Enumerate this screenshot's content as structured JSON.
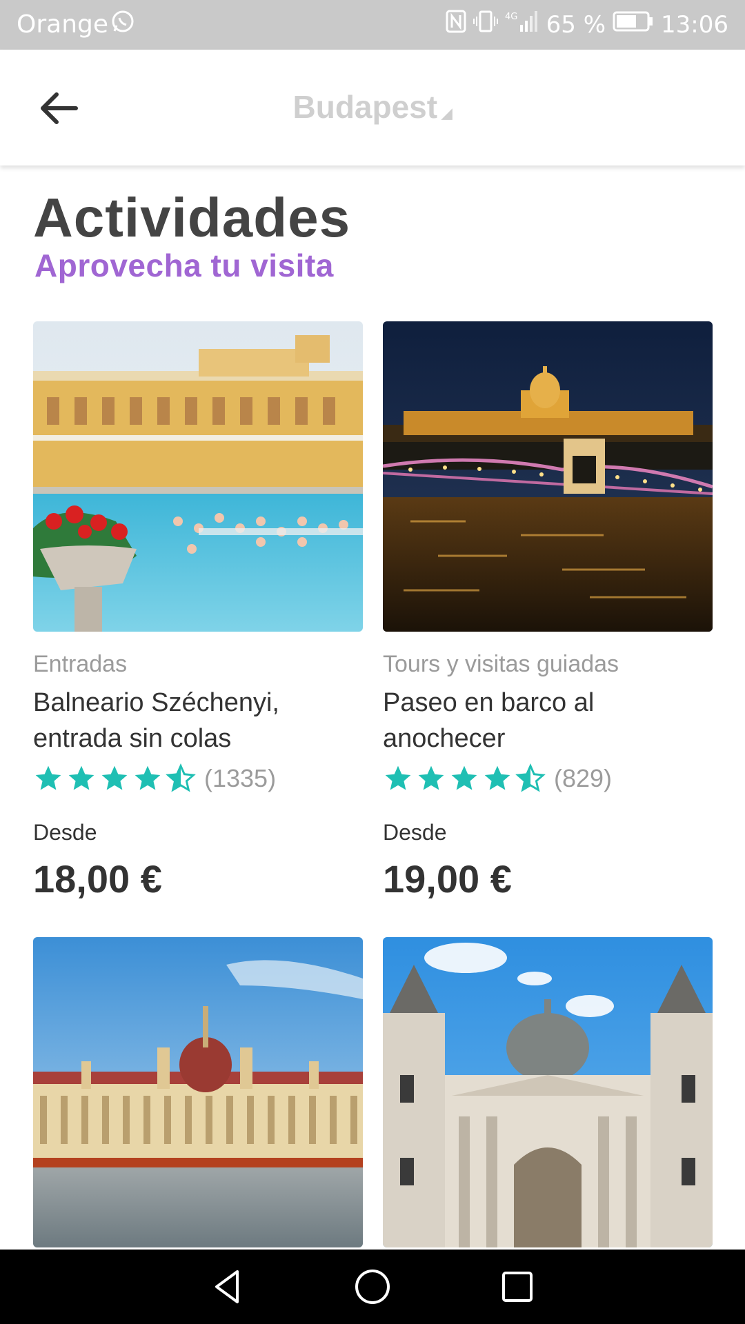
{
  "status_bar": {
    "carrier": "Orange",
    "signal": "4G",
    "battery": "65 %",
    "time": "13:06",
    "icons": [
      "whatsapp-icon",
      "nfc-icon",
      "vibrate-icon",
      "signal-icon",
      "battery-icon"
    ]
  },
  "app_bar": {
    "title": "Budapest",
    "back_icon": "arrow-left-icon"
  },
  "header": {
    "title": "Actividades",
    "subtitle": "Aprovecha tu visita"
  },
  "colors": {
    "accent": "#a066d3",
    "star": "#1fbfb3",
    "title": "#444444",
    "muted": "#9b9b9b"
  },
  "activities": [
    {
      "category": "Entradas",
      "name": "Balneario Széchenyi, entrada sin colas",
      "rating": 4.5,
      "rating_count": "(1335)",
      "from_label": "Desde",
      "price": "18,00 €"
    },
    {
      "category": "Tours y visitas guiadas",
      "name": "Paseo en barco al anochecer",
      "rating": 4.5,
      "rating_count": "(829)",
      "from_label": "Desde",
      "price": "19,00 €"
    },
    {
      "category": "",
      "name": "",
      "rating_count": "",
      "from_label": "",
      "price": ""
    },
    {
      "category": "",
      "name": "",
      "rating_count": "",
      "from_label": "",
      "price": ""
    }
  ],
  "nav_bar": {
    "buttons": [
      "back-triangle-icon",
      "home-circle-icon",
      "recents-square-icon"
    ]
  }
}
